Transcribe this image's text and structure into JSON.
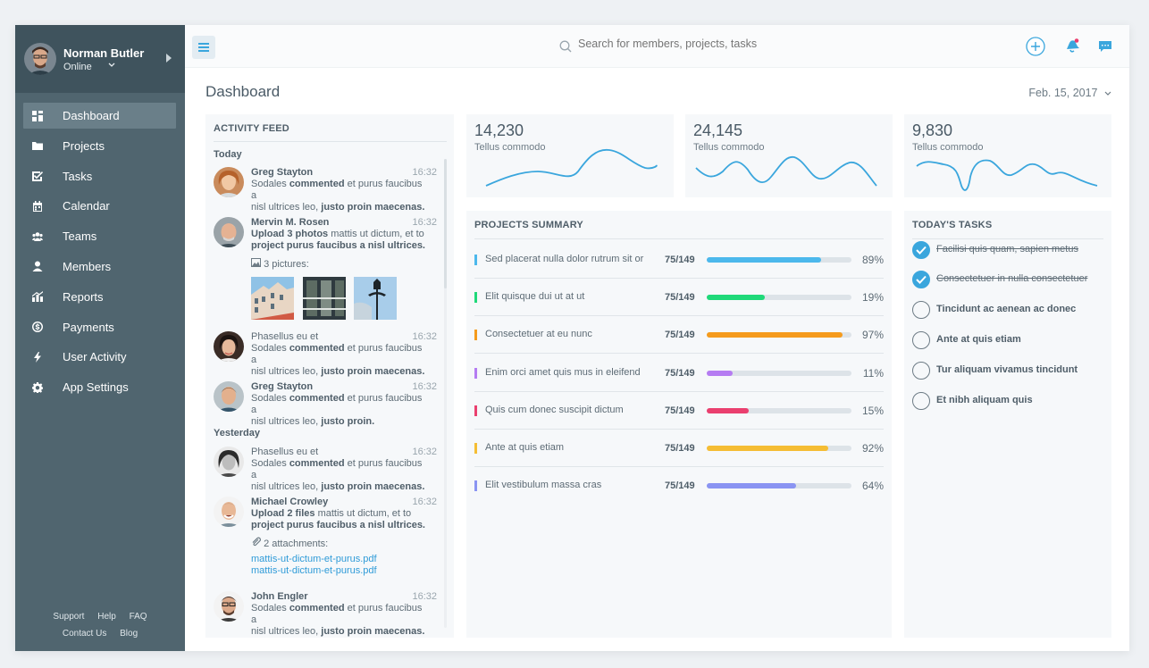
{
  "user": {
    "name": "Norman Butler",
    "status": "Online"
  },
  "nav": [
    {
      "label": "Dashboard",
      "icon": "dashboard-icon",
      "active": true
    },
    {
      "label": "Projects",
      "icon": "folder-icon"
    },
    {
      "label": "Tasks",
      "icon": "tasks-icon"
    },
    {
      "label": "Calendar",
      "icon": "calendar-icon"
    },
    {
      "label": "Teams",
      "icon": "teams-icon"
    },
    {
      "label": "Members",
      "icon": "member-icon"
    },
    {
      "label": "Reports",
      "icon": "reports-icon"
    },
    {
      "label": "Payments",
      "icon": "payments-icon"
    },
    {
      "label": "User Activity",
      "icon": "bolt-icon"
    },
    {
      "label": "App Settings",
      "icon": "gear-icon"
    }
  ],
  "footer": {
    "support": "Support",
    "help": "Help",
    "faq": "FAQ",
    "contact": "Contact Us",
    "blog": "Blog"
  },
  "search": {
    "placeholder": "Search for members, projects, tasks"
  },
  "page": {
    "title": "Dashboard",
    "date": "Feb. 15, 2017"
  },
  "feed": {
    "title": "ACTIVITY FEED",
    "today": "Today",
    "yesterday": "Yesterday",
    "entries": [
      {
        "name": "Greg Stayton",
        "time": "16:32",
        "line1_pre": "Sodales ",
        "line1_b": "commented",
        "line1_post": " et purus faucibus a",
        "line2_pre": "nisl ultrices leo, ",
        "line2_b": "justo proin maecenas."
      },
      {
        "name": "Mervin M. Rosen",
        "time": "16:32",
        "line1_pre": "",
        "line1_b": "Upload 3 photos",
        "line1_post": " mattis ut dictum, et to",
        "line2_pre": "",
        "line2_b": "project purus faucibus a nisl ultrices.",
        "pictures": "3 pictures:"
      },
      {
        "name": "Phasellus eu et",
        "time": "16:32",
        "line1_pre": "Sodales ",
        "line1_b": "commented",
        "line1_post": " et purus faucibus a",
        "line2_pre": "nisl ultrices leo, ",
        "line2_b": "justo proin maecenas."
      },
      {
        "name": "Greg Stayton",
        "time": "16:32",
        "line1_pre": "Sodales ",
        "line1_b": "commented",
        "line1_post": " et purus faucibus a",
        "line2_pre": "nisl ultrices leo, ",
        "line2_b": "justo proin."
      },
      {
        "name": "Phasellus eu et",
        "time": "16:32",
        "line1_pre": "Sodales ",
        "line1_b": "commented",
        "line1_post": " et purus faucibus a",
        "line2_pre": "nisl ultrices leo, ",
        "line2_b": "justo proin maecenas."
      },
      {
        "name": "Michael Crowley",
        "time": "16:32",
        "line1_pre": "",
        "line1_b": "Upload 2 files",
        "line1_post": " mattis ut dictum, et to",
        "line2_pre": "",
        "line2_b": "project purus faucibus a nisl ultrices.",
        "attachments": "2 attachments:",
        "file1": "mattis-ut-dictum-et-purus.pdf",
        "file2": "mattis-ut-dictum-et-purus.pdf"
      },
      {
        "name": "John Engler",
        "time": "16:32",
        "line1_pre": "Sodales ",
        "line1_b": "commented",
        "line1_post": " et purus faucibus a",
        "line2_pre": "nisl ultrices leo, ",
        "line2_b": "justo proin maecenas."
      }
    ]
  },
  "stats": [
    {
      "value": "14,230",
      "label": "Tellus commodo"
    },
    {
      "value": "24,145",
      "label": "Tellus commodo"
    },
    {
      "value": "9,830",
      "label": "Tellus commodo"
    }
  ],
  "projects": {
    "title": "PROJECTS SUMMARY",
    "rows": [
      {
        "name": "Sed placerat nulla dolor rutrum sit or",
        "count": "75/149",
        "pct": "89%",
        "value": 0.79,
        "color": "#4cb8ec"
      },
      {
        "name": "Elit quisque dui ut at ut",
        "count": "75/149",
        "pct": "19%",
        "value": 0.4,
        "color": "#1fd979"
      },
      {
        "name": "Consectetuer at eu nunc",
        "count": "75/149",
        "pct": "97%",
        "value": 0.94,
        "color": "#f59b1c"
      },
      {
        "name": "Enim orci amet quis mus in eleifend",
        "count": "75/149",
        "pct": "11%",
        "value": 0.18,
        "color": "#b57cf2"
      },
      {
        "name": "Quis cum donec suscipit dictum",
        "count": "75/149",
        "pct": "15%",
        "value": 0.29,
        "color": "#ea3f6f"
      },
      {
        "name": "Ante at quis etiam",
        "count": "75/149",
        "pct": "92%",
        "value": 0.84,
        "color": "#f5bd34"
      },
      {
        "name": "Elit vestibulum massa cras",
        "count": "75/149",
        "pct": "64%",
        "value": 0.62,
        "color": "#8a94f2"
      }
    ]
  },
  "tasks": {
    "title": "TODAY'S TASKS",
    "items": [
      {
        "label": "Facilisi quis quam, sapien metus",
        "done": true
      },
      {
        "label": "Consectetuer in nulla consectetuer",
        "done": true
      },
      {
        "label": "Tincidunt ac aenean ac donec",
        "done": false
      },
      {
        "label": "Ante at quis etiam",
        "done": false
      },
      {
        "label": "Tur aliquam vivamus tincidunt",
        "done": false
      },
      {
        "label": "Et nibh aliquam quis",
        "done": false
      }
    ]
  }
}
